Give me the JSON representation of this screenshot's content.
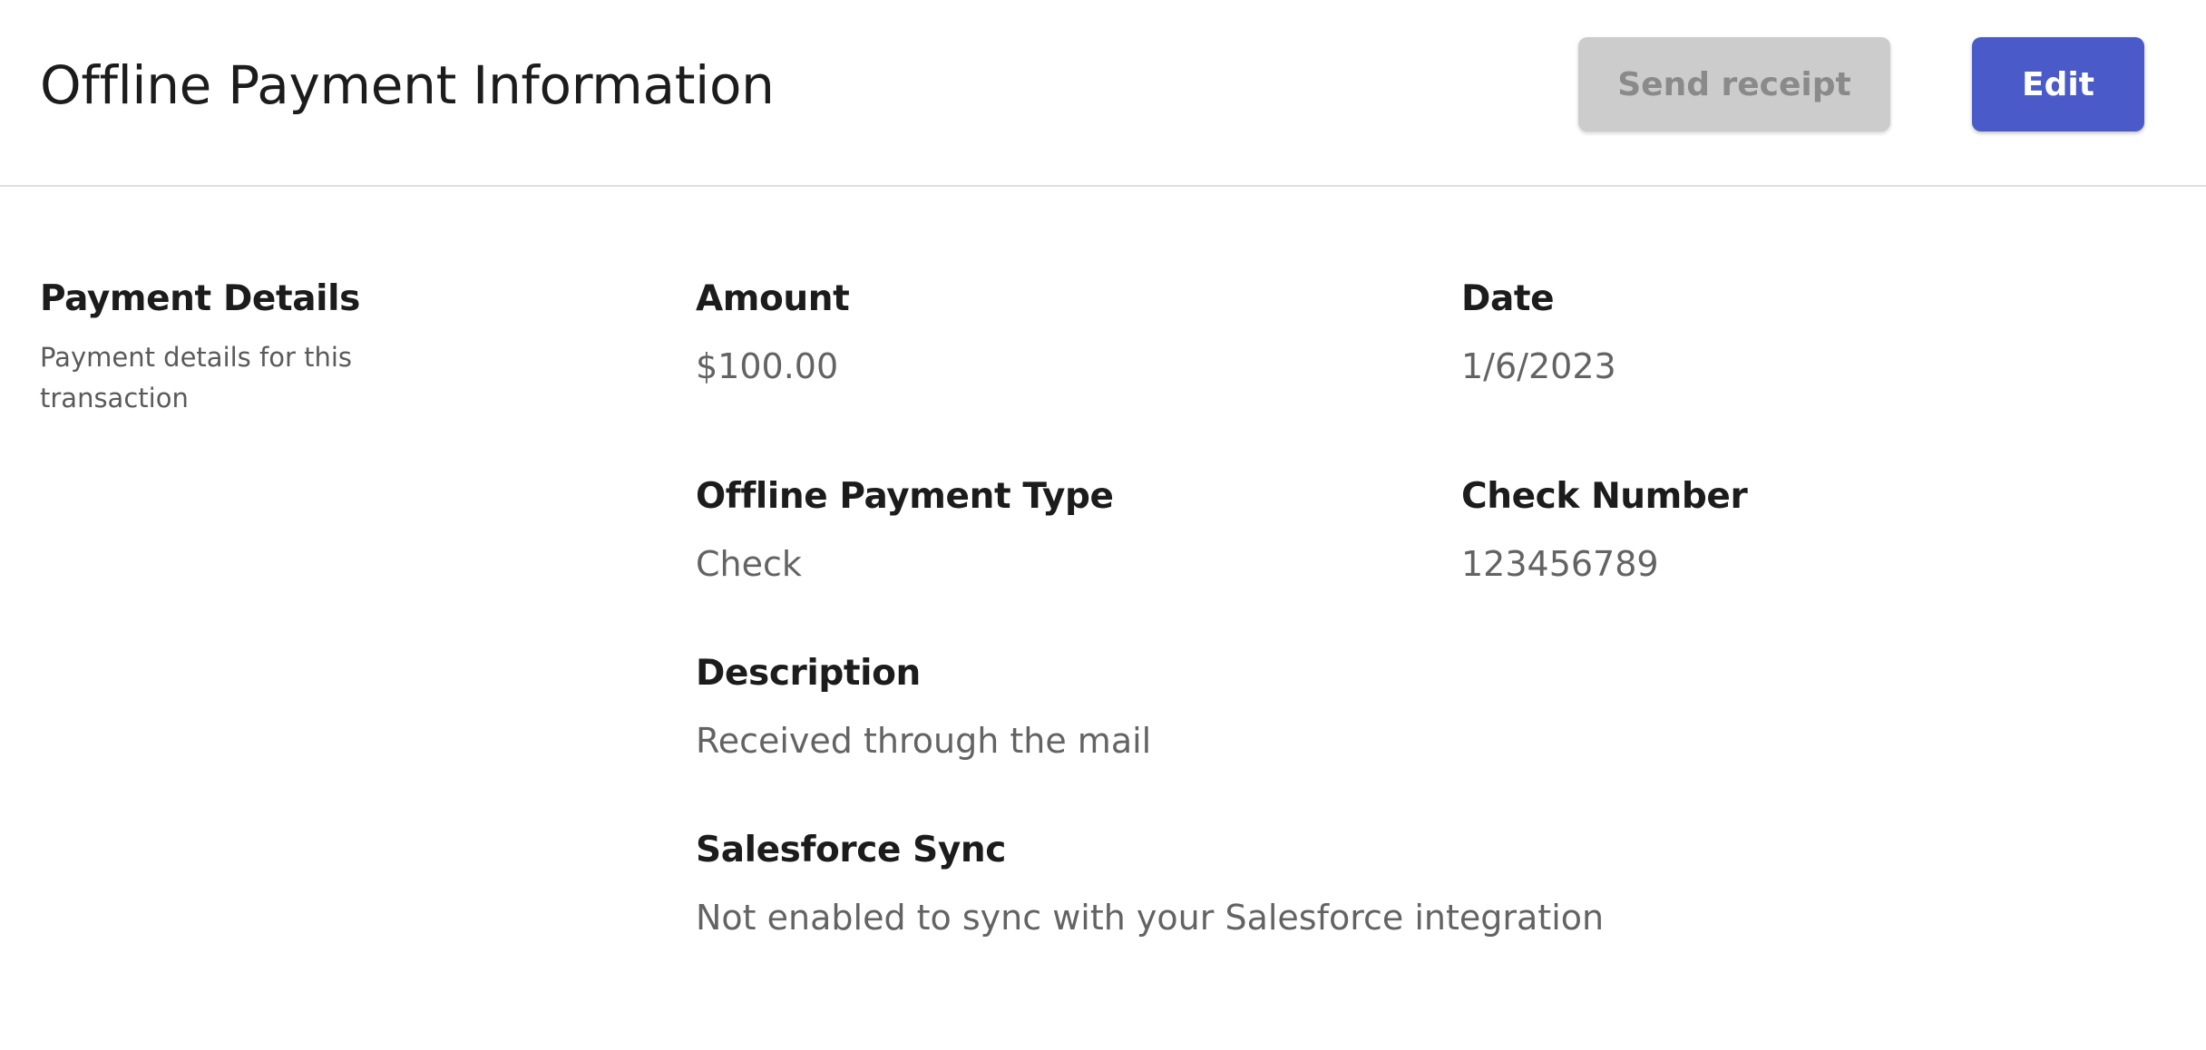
{
  "header": {
    "title": "Offline Payment Information",
    "send_receipt_label": "Send receipt",
    "edit_label": "Edit"
  },
  "section": {
    "heading": "Payment Details",
    "description": "Payment details for this transaction"
  },
  "fields": {
    "amount": {
      "label": "Amount",
      "value": "$100.00"
    },
    "date": {
      "label": "Date",
      "value": "1/6/2023"
    },
    "payment_type": {
      "label": "Offline Payment Type",
      "value": "Check"
    },
    "check_number": {
      "label": "Check Number",
      "value": "123456789"
    },
    "description": {
      "label": "Description",
      "value": "Received through the mail"
    },
    "salesforce_sync": {
      "label": "Salesforce Sync",
      "value": "Not enabled to sync with your Salesforce integration"
    }
  },
  "colors": {
    "primary": "#4a5bc9",
    "disabled_button": "#cccccc",
    "divider": "#dedede"
  }
}
